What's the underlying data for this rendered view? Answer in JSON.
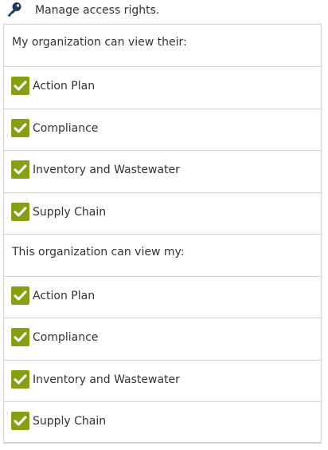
{
  "header": {
    "icon": "key-icon",
    "title": "Manage access rights."
  },
  "colors": {
    "checkbox": "#86a014",
    "check_mark": "#ffffff",
    "icon": "#1f3a5c",
    "border": "#d4d4d4"
  },
  "sections": [
    {
      "label": "My organization can view their:",
      "items": [
        {
          "label": "Action Plan",
          "checked": true
        },
        {
          "label": "Compliance",
          "checked": true
        },
        {
          "label": "Inventory and Wastewater",
          "checked": true
        },
        {
          "label": "Supply Chain",
          "checked": true
        }
      ]
    },
    {
      "label": "This organization can view my:",
      "items": [
        {
          "label": "Action Plan",
          "checked": true
        },
        {
          "label": "Compliance",
          "checked": true
        },
        {
          "label": "Inventory and Wastewater",
          "checked": true
        },
        {
          "label": "Supply Chain",
          "checked": true
        }
      ]
    }
  ]
}
